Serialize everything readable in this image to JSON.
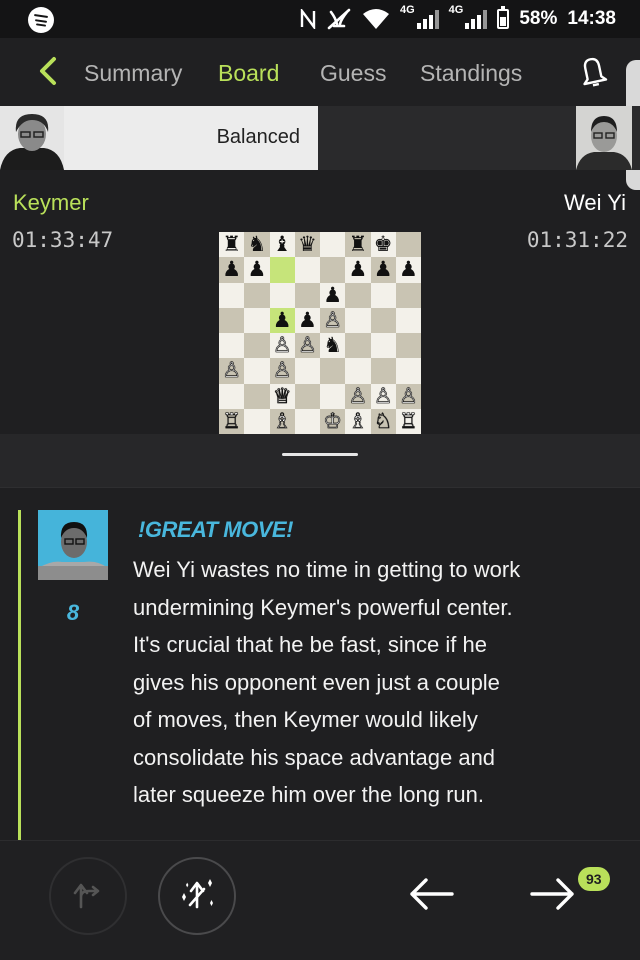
{
  "status_bar": {
    "network_1": "4G",
    "network_2": "4G",
    "battery": "58%",
    "time": "14:38",
    "icons": [
      "spotify-icon",
      "nfc-icon",
      "mute-icon",
      "wifi-icon",
      "signal-icon",
      "battery-icon"
    ]
  },
  "nav": {
    "tabs": [
      {
        "label": "Summary",
        "active": false
      },
      {
        "label": "Board",
        "active": true
      },
      {
        "label": "Guess",
        "active": false
      },
      {
        "label": "Standings",
        "active": false
      }
    ],
    "accent_color": "#b9e05a"
  },
  "eval": {
    "label": "Balanced",
    "white_share": 0.5
  },
  "players": {
    "left": {
      "name": "Keymer",
      "clock": "01:33:47",
      "name_color": "#b9e05a"
    },
    "right": {
      "name": "Wei Yi",
      "clock": "01:31:22"
    }
  },
  "board": {
    "ranks": [
      [
        "r",
        "n",
        "b",
        "q",
        "",
        "r",
        "k",
        ""
      ],
      [
        "p",
        "p",
        "",
        "",
        "",
        "p",
        "p",
        "p"
      ],
      [
        "",
        "",
        "",
        "",
        "p",
        "",
        "",
        ""
      ],
      [
        "",
        "",
        "p",
        "p",
        "P",
        "",
        "",
        ""
      ],
      [
        "",
        "",
        "P",
        "P",
        "n",
        "",
        "",
        ""
      ],
      [
        "P",
        "",
        "P",
        "",
        "",
        "",
        "",
        ""
      ],
      [
        "",
        "",
        "Q",
        "",
        "",
        "P",
        "P",
        "P"
      ],
      [
        "R",
        "",
        "B",
        "",
        "K",
        "B",
        "N",
        "R"
      ]
    ],
    "highlight": [
      "c7",
      "c5"
    ]
  },
  "comment": {
    "move_number": "8",
    "heading": "!GREAT MOVE!",
    "lines": [
      "Wei Yi wastes no time in getting to work",
      "undermining Keymer's powerful center.",
      "It's crucial that he be fast, since if he",
      "gives his opponent even just a couple",
      "of moves, then Keymer would likely",
      "consolidate his space advantage and",
      "later squeeze him over the long run."
    ],
    "highlight_color": "#49b7dd"
  },
  "bottom": {
    "badge": "93"
  }
}
